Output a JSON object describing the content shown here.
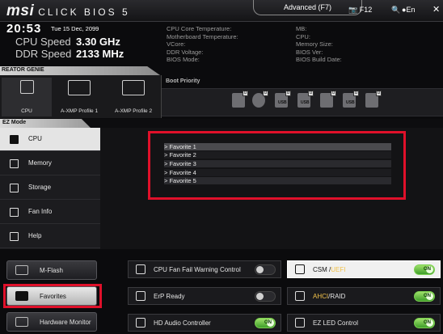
{
  "header": {
    "logo": "msi",
    "product": "CLICK BIOS 5",
    "mode_tab": "Advanced (F7)",
    "screenshot_key": "F12",
    "language": "En",
    "icons": [
      "screenshot-icon",
      "search-icon",
      "globe-icon",
      "close-icon"
    ]
  },
  "system": {
    "time": "20:53",
    "date": "Tue 15 Dec, 2099",
    "cpu_speed_label": "CPU Speed",
    "cpu_speed_value": "3.30 GHz",
    "ddr_speed_label": "DDR Speed",
    "ddr_speed_value": "2133 MHz",
    "left_info": [
      "CPU Core Temperature:",
      "Motherboard Temperature:",
      "VCore:",
      "DDR Voltage:",
      "BIOS Mode:"
    ],
    "right_info": [
      "MB:",
      "CPU:",
      "Memory Size:",
      "BIOS Ver:",
      "BIOS Build Date:"
    ]
  },
  "genie": {
    "label": "REATOR GENIE",
    "profiles": [
      {
        "label": "CPU",
        "icon": "cpu-icon"
      },
      {
        "label": "A-XMP Profile 1",
        "icon": "memory-icon"
      },
      {
        "label": "A-XMP Profile 2",
        "icon": "memory-icon"
      }
    ]
  },
  "boot_priority": {
    "title": "Boot Priority",
    "devices": [
      "hdd",
      "optical",
      "usb",
      "usb",
      "network",
      "usb",
      "drive"
    ]
  },
  "ez_mode": {
    "label": "EZ Mode"
  },
  "nav": [
    {
      "label": "CPU",
      "icon": "cpu-icon"
    },
    {
      "label": "Memory",
      "icon": "memory-icon"
    },
    {
      "label": "Storage",
      "icon": "storage-icon"
    },
    {
      "label": "Fan Info",
      "icon": "fan-icon"
    },
    {
      "label": "Help",
      "icon": "help-icon"
    }
  ],
  "favorites": [
    "Favorite 1",
    "Favorite 2",
    "Favorite 3",
    "Favorite 4",
    "Favorite 5"
  ],
  "side_buttons": [
    {
      "label": "M-Flash",
      "icon": "flash-icon"
    },
    {
      "label": "Favorites",
      "icon": "favorites-icon"
    },
    {
      "label": "Hardware Monitor",
      "icon": "monitor-icon"
    }
  ],
  "features": [
    {
      "label": "CPU Fan Fail Warning Control",
      "state": ""
    },
    {
      "label": "ErP Ready",
      "state": ""
    },
    {
      "label": "HD Audio Controller",
      "state": "ON"
    },
    {
      "label": "CSM /",
      "label_accent": "UEFI",
      "state": "ON"
    },
    {
      "label": "/RAID",
      "label_accent": "AHCI",
      "state": "ON"
    },
    {
      "label": "EZ LED Control",
      "state": "ON"
    }
  ],
  "colors": {
    "highlight": "#e0102a",
    "toggle_on": "#4fae2e",
    "accent": "#f2c24a"
  }
}
